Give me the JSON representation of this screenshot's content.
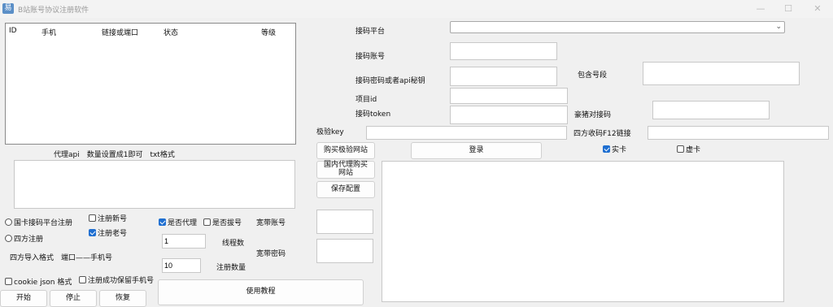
{
  "window": {
    "title": "B站账号协议注册软件",
    "icon": "app-icon"
  },
  "list": {
    "columns": [
      "ID",
      "手机",
      "链接或端口",
      "状态",
      "等级"
    ]
  },
  "proxy_api_label": "代理api　数量设置成1即可　txt格式",
  "options": {
    "guoka_register": "国卡接码平台注册",
    "sifang_register": "四方注册",
    "register_new": "注册新号",
    "register_old": "注册老号",
    "use_proxy": "是否代理",
    "use_dial": "是否拔号",
    "broadband_account": "宽带账号",
    "broadband_password": "宽带密码",
    "thread_count_label": "线程数",
    "thread_count": "1",
    "register_count_label": "注册数量",
    "register_count": "10",
    "import_format": "四方导入格式　端口——手机号",
    "cookie_json": "cookie  json  格式",
    "keep_phone": "注册成功保留手机号"
  },
  "buttons": {
    "start": "开始",
    "stop": "停止",
    "restore": "恢复",
    "tutorial": "使用教程",
    "buy_jiyan": "购买极验网站",
    "domestic_proxy": "国内代理购买网站",
    "save_config": "保存配置",
    "login": "登录"
  },
  "form": {
    "platform_label": "接码平台",
    "account_label": "接码账号",
    "password_label": "接码密码或者api秘钥",
    "project_label": "项目id",
    "token_label": "接码token",
    "jiyan_key_label": "极验key",
    "include_segment_label": "包含号段",
    "haozhu_label": "豪猪对接码",
    "sifang_link_label": "四方收码F12链接",
    "real_card": "实卡",
    "virtual_card": "虚卡"
  }
}
